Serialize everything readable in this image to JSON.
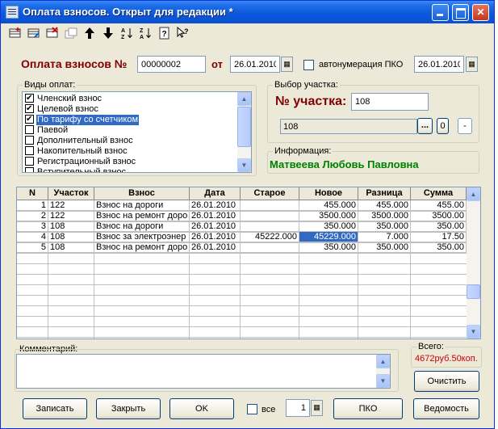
{
  "window": {
    "title": "Оплата взносов. Открыт для редакции *"
  },
  "toolbar": {
    "icons": [
      "add-record-icon",
      "edit-record-icon",
      "delete-record-icon",
      "copy-record-icon",
      "arrow-up-icon",
      "arrow-down-icon",
      "sort-asc-icon",
      "sort-desc-icon",
      "help-icon",
      "context-help-icon"
    ]
  },
  "header": {
    "title": "Оплата взносов №",
    "number": "00000002",
    "from_label": "от",
    "date": "26.01.2010",
    "autonumber_label": "автонумерация ПКО",
    "pko_date": "26.01.2010"
  },
  "payment_types": {
    "group_title": "Виды оплат:",
    "items": [
      {
        "label": "Членский взнос",
        "checked": true,
        "selected": false
      },
      {
        "label": "Целевой взнос",
        "checked": true,
        "selected": false
      },
      {
        "label": "По тарифу со счетчиком",
        "checked": true,
        "selected": true
      },
      {
        "label": "Паевой",
        "checked": false,
        "selected": false
      },
      {
        "label": "Дополнительный взнос",
        "checked": false,
        "selected": false
      },
      {
        "label": "Накопительный взнос",
        "checked": false,
        "selected": false
      },
      {
        "label": "Регистрационный взнос",
        "checked": false,
        "selected": false
      },
      {
        "label": "Вступительный взнос",
        "checked": false,
        "selected": false
      }
    ]
  },
  "plot_select": {
    "group_title": "Выбор участка:",
    "label": "№ участка:",
    "number": "108",
    "combo_value": "108",
    "browse_label": "...",
    "zero_label": "0",
    "dash_label": "-"
  },
  "info": {
    "group_title": "Информация:",
    "owner": "Матвеева Любовь Павловна",
    "owner_color": "#008000"
  },
  "table": {
    "columns": [
      "N",
      "Участок",
      "Взнос",
      "Дата",
      "Старое",
      "Новое",
      "Разница",
      "Сумма"
    ],
    "rows": [
      [
        "1",
        "122",
        "Взнос на дороги",
        "26.01.2010",
        "",
        "455.000",
        "455.000",
        "455.00"
      ],
      [
        "2",
        "122",
        "Взнос на ремонт доро",
        "26.01.2010",
        "",
        "3500.000",
        "3500.000",
        "3500.00"
      ],
      [
        "3",
        "108",
        "Взнос на дороги",
        "26.01.2010",
        "",
        "350.000",
        "350.000",
        "350.00"
      ],
      [
        "4",
        "108",
        "Взнос за электроэнер",
        "26.01.2010",
        "45222.000",
        "45229.000",
        "7.000",
        "17.50"
      ],
      [
        "5",
        "108",
        "Взнос на ремонт доро",
        "26.01.2010",
        "",
        "350.000",
        "350.000",
        "350.00"
      ]
    ],
    "selected_cell": {
      "row": 3,
      "col": 5
    },
    "current_row": 3
  },
  "comment": {
    "label": "Комментарий:"
  },
  "total": {
    "label": "Всего:",
    "value": "4672руб.50коп.",
    "value_color": "#cc0000"
  },
  "buttons": {
    "clear": "Очистить",
    "save": "Записать",
    "close": "Закрыть",
    "ok": "OK",
    "all": "все",
    "copies": "1",
    "pko": "ПКО",
    "statement": "Ведомость"
  },
  "colors": {
    "title_red": "#800000",
    "selection": "#316ac5",
    "titlebar": "#0a58dd"
  }
}
